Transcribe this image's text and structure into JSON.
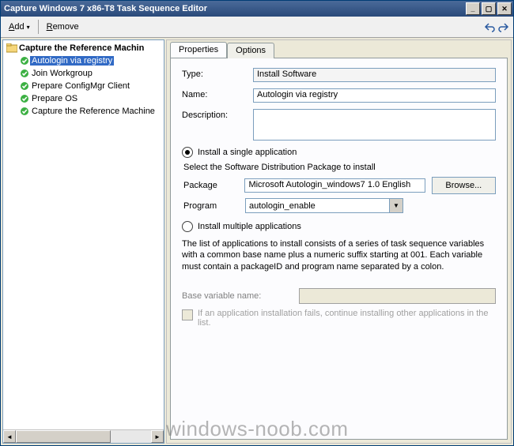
{
  "window": {
    "title": "Capture Windows 7 x86-T8 Task Sequence Editor",
    "min_label": "_",
    "max_label": "▢",
    "close_label": "✕"
  },
  "toolbar": {
    "add_html": "<u>A</u>dd",
    "remove_html": "<u>R</u>emove"
  },
  "tree": {
    "root": "Capture the Reference Machin",
    "items": [
      {
        "label": "Autologin via registry",
        "selected": true
      },
      {
        "label": "Join Workgroup",
        "selected": false
      },
      {
        "label": "Prepare ConfigMgr Client",
        "selected": false
      },
      {
        "label": "Prepare OS",
        "selected": false
      },
      {
        "label": "Capture the Reference Machine",
        "selected": false
      }
    ]
  },
  "tabs": {
    "properties": "Properties",
    "options": "Options"
  },
  "props": {
    "type_label": "Type:",
    "type_value": "Install Software",
    "name_label": "Name:",
    "name_value": "Autologin via registry",
    "desc_label": "Description:",
    "desc_value": "",
    "radio_single": "Install a single application",
    "select_pkg_text": "Select the Software Distribution Package to install",
    "package_label": "Package",
    "package_value": "Microsoft Autologin_windows7 1.0 English",
    "browse_label": "Browse...",
    "program_label": "Program",
    "program_value": "autologin_enable",
    "radio_multi": "Install multiple applications",
    "explain": "The list of applications to install consists of a series of task sequence variables with a common base name plus a numeric suffix starting at 001.  Each variable must contain a packageID and program name separated by a colon.",
    "base_label": "Base variable name:",
    "fail_label": "If an application installation fails, continue installing other applications in the list."
  },
  "watermark": "windows-noob.com"
}
